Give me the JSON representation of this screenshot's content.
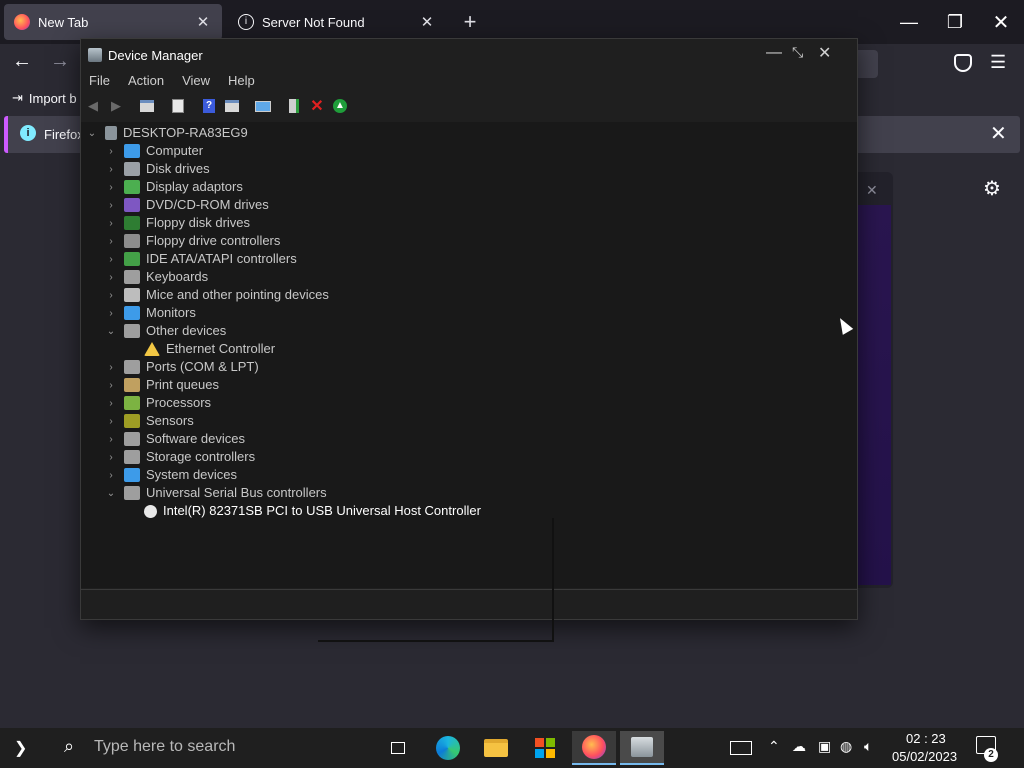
{
  "browser": {
    "tabs": [
      {
        "label": "New Tab",
        "icon": "firefox-icon",
        "active": true
      },
      {
        "label": "Server Not Found",
        "icon": "info-icon",
        "active": false
      }
    ],
    "new_tab_symbol": "+",
    "bookmark_import_label": "Import b",
    "notification_text": "Firefox"
  },
  "device_manager": {
    "title": "Device Manager",
    "menu": [
      "File",
      "Action",
      "View",
      "Help"
    ],
    "toolbar_icons": [
      "back-icon",
      "forward-icon",
      "show-hide-tree-icon",
      "properties-icon",
      "help-icon",
      "action-pane-icon",
      "scan-hardware-icon",
      "add-driver-icon",
      "uninstall-icon",
      "update-driver-icon"
    ],
    "tree": {
      "root": "DESKTOP-RA83EG9",
      "categories": [
        {
          "label": "Computer",
          "expanded": false,
          "icon_color": "#3d9be9"
        },
        {
          "label": "Disk drives",
          "expanded": false,
          "icon_color": "#9aa0a6"
        },
        {
          "label": "Display adaptors",
          "expanded": false,
          "icon_color": "#4caf50"
        },
        {
          "label": "DVD/CD-ROM drives",
          "expanded": false,
          "icon_color": "#7e57c2"
        },
        {
          "label": "Floppy disk drives",
          "expanded": false,
          "icon_color": "#2e7d32"
        },
        {
          "label": "Floppy drive controllers",
          "expanded": false,
          "icon_color": "#8d8d8d"
        },
        {
          "label": "IDE ATA/ATAPI controllers",
          "expanded": false,
          "icon_color": "#43a047"
        },
        {
          "label": "Keyboards",
          "expanded": false,
          "icon_color": "#9e9e9e"
        },
        {
          "label": "Mice and other pointing devices",
          "expanded": false,
          "icon_color": "#bdbdbd"
        },
        {
          "label": "Monitors",
          "expanded": false,
          "icon_color": "#3d9be9"
        },
        {
          "label": "Other devices",
          "expanded": true,
          "icon_color": "#9e9e9e",
          "children": [
            {
              "label": "Ethernet Controller",
              "warning": true
            }
          ]
        },
        {
          "label": "Ports (COM & LPT)",
          "expanded": false,
          "icon_color": "#9e9e9e"
        },
        {
          "label": "Print queues",
          "expanded": false,
          "icon_color": "#c0a060"
        },
        {
          "label": "Processors",
          "expanded": false,
          "icon_color": "#7cb342"
        },
        {
          "label": "Sensors",
          "expanded": false,
          "icon_color": "#9e9d24"
        },
        {
          "label": "Software devices",
          "expanded": false,
          "icon_color": "#9e9e9e"
        },
        {
          "label": "Storage controllers",
          "expanded": false,
          "icon_color": "#9e9e9e"
        },
        {
          "label": "System devices",
          "expanded": false,
          "icon_color": "#3d9be9"
        },
        {
          "label": "Universal Serial Bus controllers",
          "expanded": true,
          "icon_color": "#9e9e9e",
          "children": [
            {
              "label": "Intel(R) 82371SB PCI to USB Universal Host Controller",
              "warning": false,
              "disabled": true
            }
          ]
        }
      ]
    }
  },
  "taskbar": {
    "search_placeholder": "Type here to search",
    "clock_time": "02 : 23",
    "clock_date": "05/02/2023",
    "notification_count": "2",
    "apps": [
      "task-view-icon",
      "edge-icon",
      "file-explorer-icon",
      "store-icon",
      "firefox-icon",
      "device-manager-icon"
    ]
  }
}
